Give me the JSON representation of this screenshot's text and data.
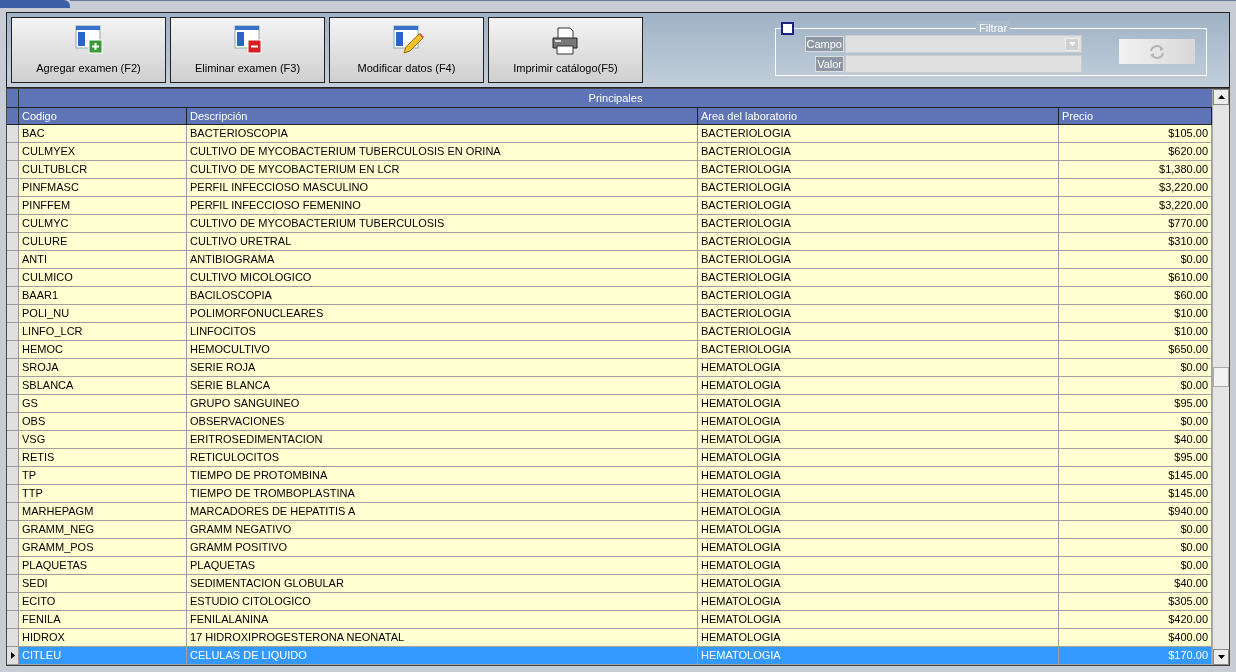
{
  "toolbar": [
    {
      "kind": "add",
      "label": "Agregar examen (F2)"
    },
    {
      "kind": "remove",
      "label": "Eliminar examen (F3)"
    },
    {
      "kind": "edit",
      "label": "Modificar datos (F4)"
    },
    {
      "kind": "print",
      "label": "Imprimir catálogo(F5)"
    }
  ],
  "filter": {
    "title": "Filtrar",
    "checked": false,
    "field_label": "Campo",
    "value_label": "Valor"
  },
  "table": {
    "band": "Principales",
    "columns": [
      "Codigo",
      "Descripción",
      "Area del laboratorio",
      "Precio"
    ],
    "rows": [
      {
        "cells": [
          "BAC",
          "BACTERIOSCOPIA",
          "BACTERIOLOGIA",
          "$105.00"
        ],
        "selected": false
      },
      {
        "cells": [
          "CULMYEX",
          "CULTIVO DE MYCOBACTERIUM TUBERCULOSIS EN ORINA",
          "BACTERIOLOGIA",
          "$620.00"
        ],
        "selected": false
      },
      {
        "cells": [
          "CULTUBLCR",
          "CULTIVO DE MYCOBACTERIUM EN LCR",
          "BACTERIOLOGIA",
          "$1,380.00"
        ],
        "selected": false
      },
      {
        "cells": [
          "PINFMASC",
          "PERFIL INFECCIOSO MASCULINO",
          "BACTERIOLOGIA",
          "$3,220.00"
        ],
        "selected": false
      },
      {
        "cells": [
          "PINFFEM",
          "PERFIL INFECCIOSO FEMENINO",
          "BACTERIOLOGIA",
          "$3,220.00"
        ],
        "selected": false
      },
      {
        "cells": [
          "CULMYC",
          "CULTIVO DE MYCOBACTERIUM TUBERCULOSIS",
          "BACTERIOLOGIA",
          "$770.00"
        ],
        "selected": false
      },
      {
        "cells": [
          "CULURE",
          "CULTIVO URETRAL",
          "BACTERIOLOGIA",
          "$310.00"
        ],
        "selected": false
      },
      {
        "cells": [
          "ANTI",
          "ANTIBIOGRAMA",
          "BACTERIOLOGIA",
          "$0.00"
        ],
        "selected": false
      },
      {
        "cells": [
          "CULMICO",
          "CULTIVO MICOLOGICO",
          "BACTERIOLOGIA",
          "$610.00"
        ],
        "selected": false
      },
      {
        "cells": [
          "BAAR1",
          "BACILOSCOPIA",
          "BACTERIOLOGIA",
          "$60.00"
        ],
        "selected": false
      },
      {
        "cells": [
          "POLI_NU",
          "POLIMORFONUCLEARES",
          "BACTERIOLOGIA",
          "$10.00"
        ],
        "selected": false
      },
      {
        "cells": [
          "LINFO_LCR",
          "LINFOCITOS",
          "BACTERIOLOGIA",
          "$10.00"
        ],
        "selected": false
      },
      {
        "cells": [
          "HEMOC",
          "HEMOCULTIVO",
          "BACTERIOLOGIA",
          "$650.00"
        ],
        "selected": false
      },
      {
        "cells": [
          "SROJA",
          "SERIE ROJA",
          "HEMATOLOGIA",
          "$0.00"
        ],
        "selected": false
      },
      {
        "cells": [
          "SBLANCA",
          "SERIE BLANCA",
          "HEMATOLOGIA",
          "$0.00"
        ],
        "selected": false
      },
      {
        "cells": [
          "GS",
          "GRUPO SANGUINEO",
          "HEMATOLOGIA",
          "$95.00"
        ],
        "selected": false
      },
      {
        "cells": [
          "OBS",
          "OBSERVACIONES",
          "HEMATOLOGIA",
          "$0.00"
        ],
        "selected": false
      },
      {
        "cells": [
          "VSG",
          "ERITROSEDIMENTACION",
          "HEMATOLOGIA",
          "$40.00"
        ],
        "selected": false
      },
      {
        "cells": [
          "RETIS",
          "RETICULOCITOS",
          "HEMATOLOGIA",
          "$95.00"
        ],
        "selected": false
      },
      {
        "cells": [
          "TP",
          "TIEMPO DE PROTOMBINA",
          "HEMATOLOGIA",
          "$145.00"
        ],
        "selected": false
      },
      {
        "cells": [
          "TTP",
          "TIEMPO DE TROMBOPLASTINA",
          "HEMATOLOGIA",
          "$145.00"
        ],
        "selected": false
      },
      {
        "cells": [
          "MARHEPAGM",
          "MARCADORES DE HEPATITIS A",
          "HEMATOLOGIA",
          "$940.00"
        ],
        "selected": false
      },
      {
        "cells": [
          "GRAMM_NEG",
          "GRAMM NEGATIVO",
          "HEMATOLOGIA",
          "$0.00"
        ],
        "selected": false
      },
      {
        "cells": [
          "GRAMM_POS",
          "GRAMM POSITIVO",
          "HEMATOLOGIA",
          "$0.00"
        ],
        "selected": false
      },
      {
        "cells": [
          "PLAQUETAS",
          "PLAQUETAS",
          "HEMATOLOGIA",
          "$0.00"
        ],
        "selected": false
      },
      {
        "cells": [
          "SEDI",
          "SEDIMENTACION GLOBULAR",
          "HEMATOLOGIA",
          "$40.00"
        ],
        "selected": false
      },
      {
        "cells": [
          "ECITO",
          "ESTUDIO CITOLOGICO",
          "HEMATOLOGIA",
          "$305.00"
        ],
        "selected": false
      },
      {
        "cells": [
          "FENILA",
          "FENILALANINA",
          "HEMATOLOGIA",
          "$420.00"
        ],
        "selected": false
      },
      {
        "cells": [
          "HIDROX",
          "17 HIDROXIPROGESTERONA NEONATAL",
          "HEMATOLOGIA",
          "$400.00"
        ],
        "selected": false
      },
      {
        "cells": [
          "CITLEU",
          "CELULAS DE LIQUIDO",
          "HEMATOLOGIA",
          "$170.00"
        ],
        "selected": true
      }
    ]
  }
}
